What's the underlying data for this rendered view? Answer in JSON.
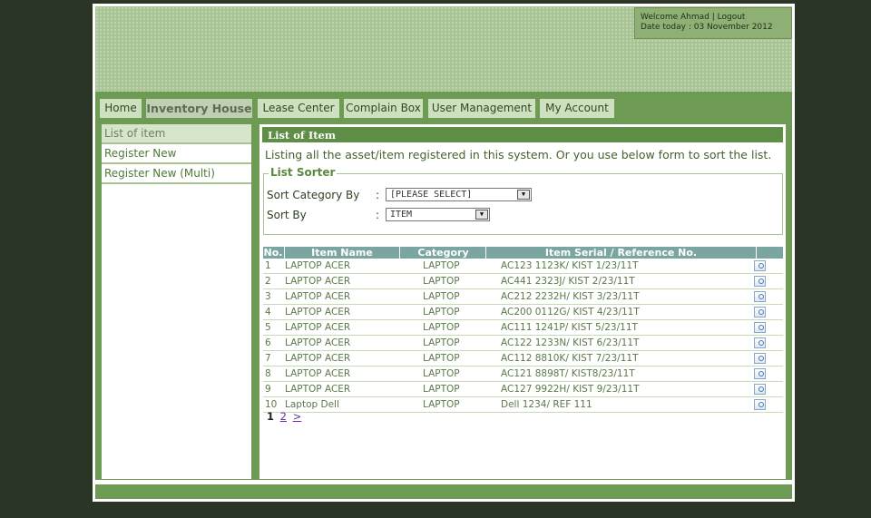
{
  "header": {
    "welcome": "Welcome Ahmad | Logout",
    "date": "Date today : 03 November 2012"
  },
  "nav": {
    "tabs": [
      "Home",
      "Inventory House",
      "Lease Center",
      "Complain Box",
      "User Management",
      "My Account"
    ],
    "active": "Inventory House"
  },
  "sidebar": {
    "items": [
      "List of item",
      "Register New",
      "Register New (Multi)"
    ],
    "active": "List of item"
  },
  "main": {
    "title": "List of Item",
    "description": "Listing all the asset/item registered in this system. Or you use below form to sort the list.",
    "sorter": {
      "legend": "List Sorter",
      "category_label": "Sort Category By",
      "category_value": "[PLEASE SELECT]",
      "sort_label": "Sort By",
      "sort_value": "ITEM"
    },
    "table": {
      "headers": [
        "No.",
        "Item Name",
        "Category",
        "Item Serial / Reference No."
      ],
      "rows": [
        {
          "no": "1",
          "name": "LAPTOP ACER",
          "category": "LAPTOP",
          "serial": "AC123 1123K/ KIST 1/23/11T"
        },
        {
          "no": "2",
          "name": "LAPTOP ACER",
          "category": "LAPTOP",
          "serial": "AC441 2323J/ KIST 2/23/11T"
        },
        {
          "no": "3",
          "name": "LAPTOP ACER",
          "category": "LAPTOP",
          "serial": "AC212 2232H/ KIST 3/23/11T"
        },
        {
          "no": "4",
          "name": "LAPTOP ACER",
          "category": "LAPTOP",
          "serial": "AC200 0112G/ KIST 4/23/11T"
        },
        {
          "no": "5",
          "name": "LAPTOP ACER",
          "category": "LAPTOP",
          "serial": "AC111 1241P/ KIST 5/23/11T"
        },
        {
          "no": "6",
          "name": "LAPTOP ACER",
          "category": "LAPTOP",
          "serial": "AC122 1233N/ KIST 6/23/11T"
        },
        {
          "no": "7",
          "name": "LAPTOP ACER",
          "category": "LAPTOP",
          "serial": "AC112 8810K/ KIST 7/23/11T"
        },
        {
          "no": "8",
          "name": "LAPTOP ACER",
          "category": "LAPTOP",
          "serial": "AC121 8898T/ KIST8/23/11T"
        },
        {
          "no": "9",
          "name": "LAPTOP ACER",
          "category": "LAPTOP",
          "serial": "AC127 9922H/ KIST 9/23/11T"
        },
        {
          "no": "10",
          "name": "Laptop Dell",
          "category": "LAPTOP",
          "serial": "Dell 1234/ REF 111"
        }
      ]
    },
    "pager": {
      "current": "1",
      "pages": [
        "2",
        ">"
      ]
    }
  },
  "colors": {
    "nav_green": "#6d9b53",
    "header_green": "#a9c495",
    "table_header": "#7aa5a1",
    "background": "#2a3526"
  }
}
